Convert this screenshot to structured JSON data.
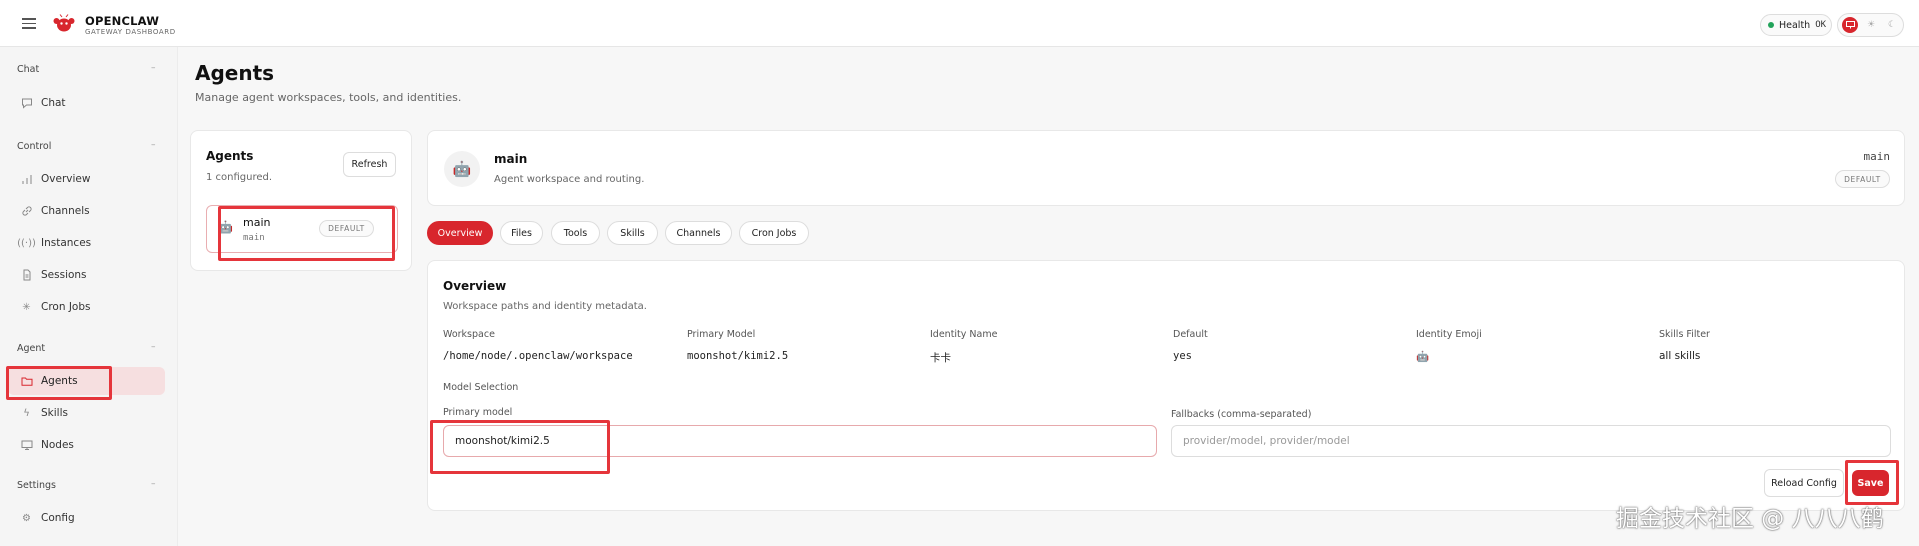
{
  "app": {
    "brand": "OPENCLAW",
    "subtitle": "GATEWAY DASHBOARD"
  },
  "header": {
    "health_label": "Health",
    "health_status": "OK",
    "theme_options": [
      "monitor-icon",
      "sun-icon",
      "moon-icon"
    ]
  },
  "sidebar": {
    "sections": [
      {
        "title": "Chat",
        "items": [
          {
            "label": "Chat",
            "icon": "chat-icon"
          }
        ]
      },
      {
        "title": "Control",
        "items": [
          {
            "label": "Overview",
            "icon": "bar-chart-icon"
          },
          {
            "label": "Channels",
            "icon": "link-icon"
          },
          {
            "label": "Instances",
            "icon": "broadcast-icon"
          },
          {
            "label": "Sessions",
            "icon": "document-icon"
          },
          {
            "label": "Cron Jobs",
            "icon": "loader-icon"
          }
        ]
      },
      {
        "title": "Agent",
        "items": [
          {
            "label": "Agents",
            "icon": "folder-icon",
            "active": true
          },
          {
            "label": "Skills",
            "icon": "bolt-icon"
          },
          {
            "label": "Nodes",
            "icon": "monitor-icon"
          }
        ]
      },
      {
        "title": "Settings",
        "items": [
          {
            "label": "Config",
            "icon": "gear-icon"
          }
        ]
      }
    ]
  },
  "page": {
    "title": "Agents",
    "subtitle": "Manage agent workspaces, tools, and identities."
  },
  "agents_panel": {
    "title": "Agents",
    "count_text": "1 configured.",
    "refresh_label": "Refresh",
    "agents": [
      {
        "name": "main",
        "id": "main",
        "badge": "DEFAULT",
        "emoji": "🤖"
      }
    ]
  },
  "agent_header": {
    "name": "main",
    "subtitle": "Agent workspace and routing.",
    "id": "main",
    "badge": "DEFAULT",
    "emoji": "🤖"
  },
  "tabs": [
    "Overview",
    "Files",
    "Tools",
    "Skills",
    "Channels",
    "Cron Jobs"
  ],
  "active_tab": "Overview",
  "overview": {
    "title": "Overview",
    "subtitle": "Workspace paths and identity metadata.",
    "fields": [
      {
        "label": "Workspace",
        "value": "/home/node/.openclaw/workspace"
      },
      {
        "label": "Primary Model",
        "value": "moonshot/kimi2.5"
      },
      {
        "label": "Identity Name",
        "value": "卡卡"
      },
      {
        "label": "Default",
        "value": "yes"
      },
      {
        "label": "Identity Emoji",
        "value": "🤖"
      },
      {
        "label": "Skills Filter",
        "value": "all skills"
      }
    ],
    "model_selection_label": "Model Selection",
    "primary_model_label": "Primary model",
    "primary_model_value": "moonshot/kimi2.5",
    "fallbacks_label": "Fallbacks (comma-separated)",
    "fallbacks_placeholder": "provider/model, provider/model",
    "reload_label": "Reload Config",
    "save_label": "Save"
  },
  "watermark": "掘金技术社区 @ 八八八鹤",
  "colors": {
    "accent": "#d8262d",
    "active_bg": "#f6dfe0",
    "highlight": "#e5353b"
  }
}
